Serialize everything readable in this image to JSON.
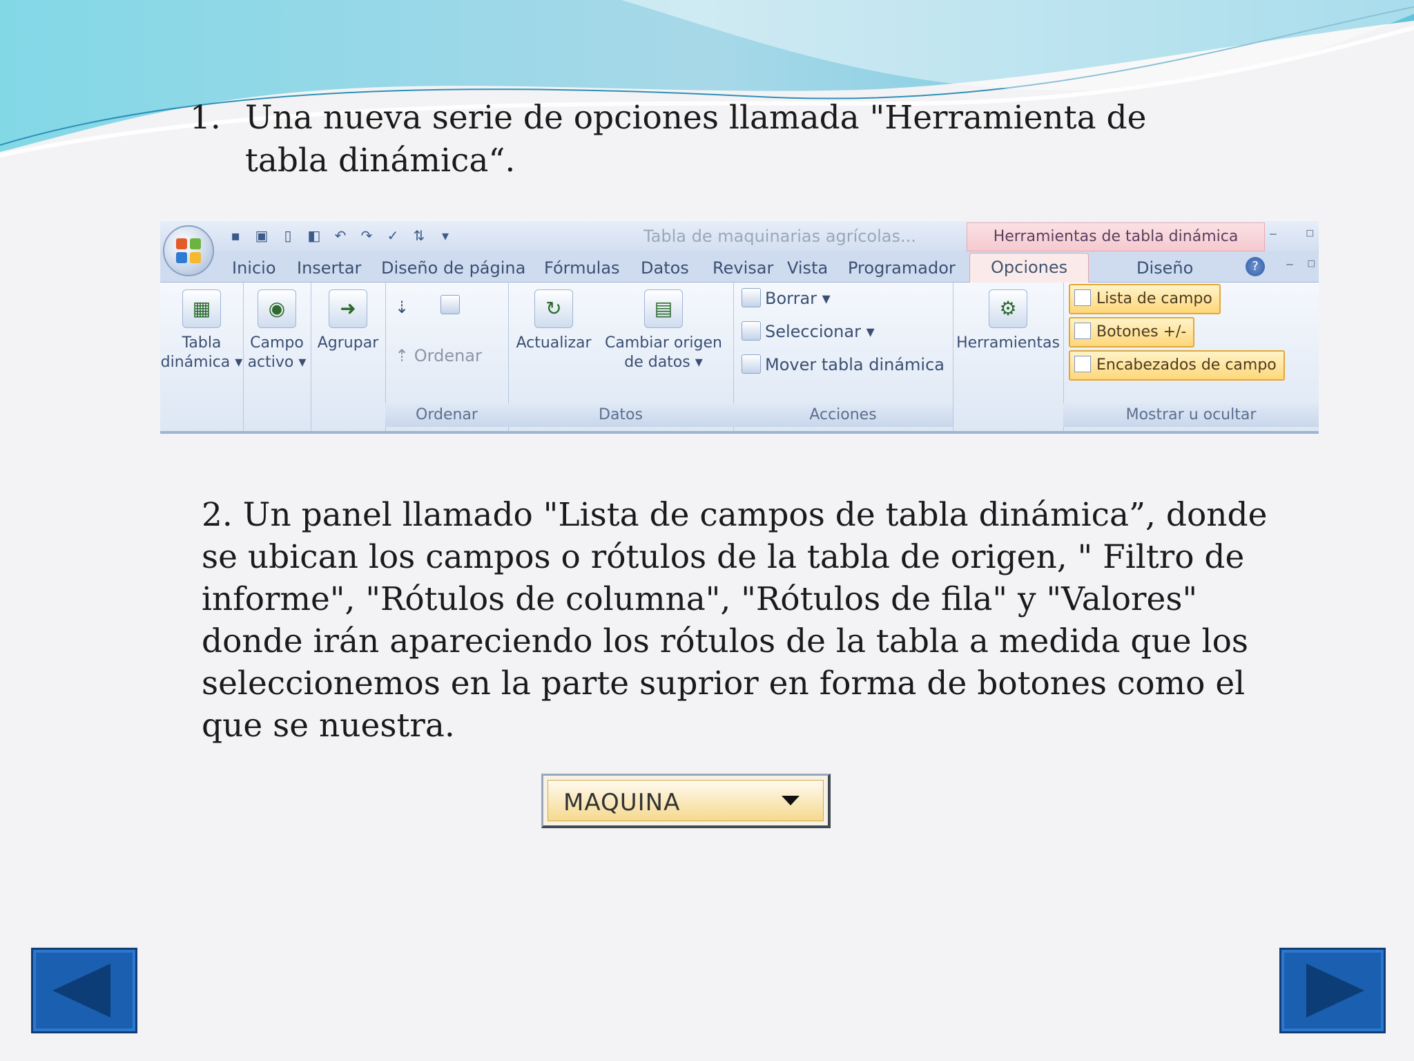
{
  "slide": {
    "point1": {
      "number": "1.",
      "text": "Una nueva serie de opciones llamada \"Herramienta de tabla dinámica“."
    },
    "point2": {
      "text": "2. Un panel llamado \"Lista de campos de tabla dinámica”, donde se ubican los campos o rótulos de la tabla de origen, \" Filtro de informe\", \"Rótulos de columna\", \"Rótulos de fila\" y  \"Valores\" donde irán apareciendo los rótulos de la tabla a medida que los seleccionemos en la parte suprior en forma de botones como el que se nuestra."
    }
  },
  "ribbon": {
    "window_title": "Tabla de maquinarias agrícolas...",
    "contextual_title": "Herramientas de tabla dinámica",
    "tabs": [
      "Inicio",
      "Insertar",
      "Diseño de página",
      "Fórmulas",
      "Datos",
      "Revisar",
      "Vista",
      "Programador",
      "Opciones",
      "Diseño"
    ],
    "active_tab": "Opciones",
    "buttons": {
      "tabla_dinamica": "Tabla dinámica ▾",
      "campo_activo": "Campo activo ▾",
      "agrupar": "Agrupar",
      "ordenar": "Ordenar",
      "actualizar": "Actualizar",
      "cambiar_origen": "Cambiar origen de datos ▾",
      "borrar": "Borrar ▾",
      "seleccionar": "Seleccionar ▾",
      "mover": "Mover tabla dinámica",
      "herramientas": "Herramientas",
      "lista_campo": "Lista de campo",
      "botones": "Botones +/-",
      "encabezados": "Encabezados de campo"
    },
    "groups": {
      "ordenar": "Ordenar",
      "datos": "Datos",
      "acciones": "Acciones",
      "mostrar": "Mostrar u ocultar"
    },
    "colors": {
      "accent": "#dfe8f5",
      "contextual": "#f5c9cf",
      "highlight": "#ffd77a"
    }
  },
  "field_button": {
    "label": "MAQUINA",
    "icon": "chevron-down-icon"
  },
  "navigation": {
    "prev_icon": "arrow-left-icon",
    "next_icon": "arrow-right-icon",
    "color": "#1b5fb0"
  }
}
